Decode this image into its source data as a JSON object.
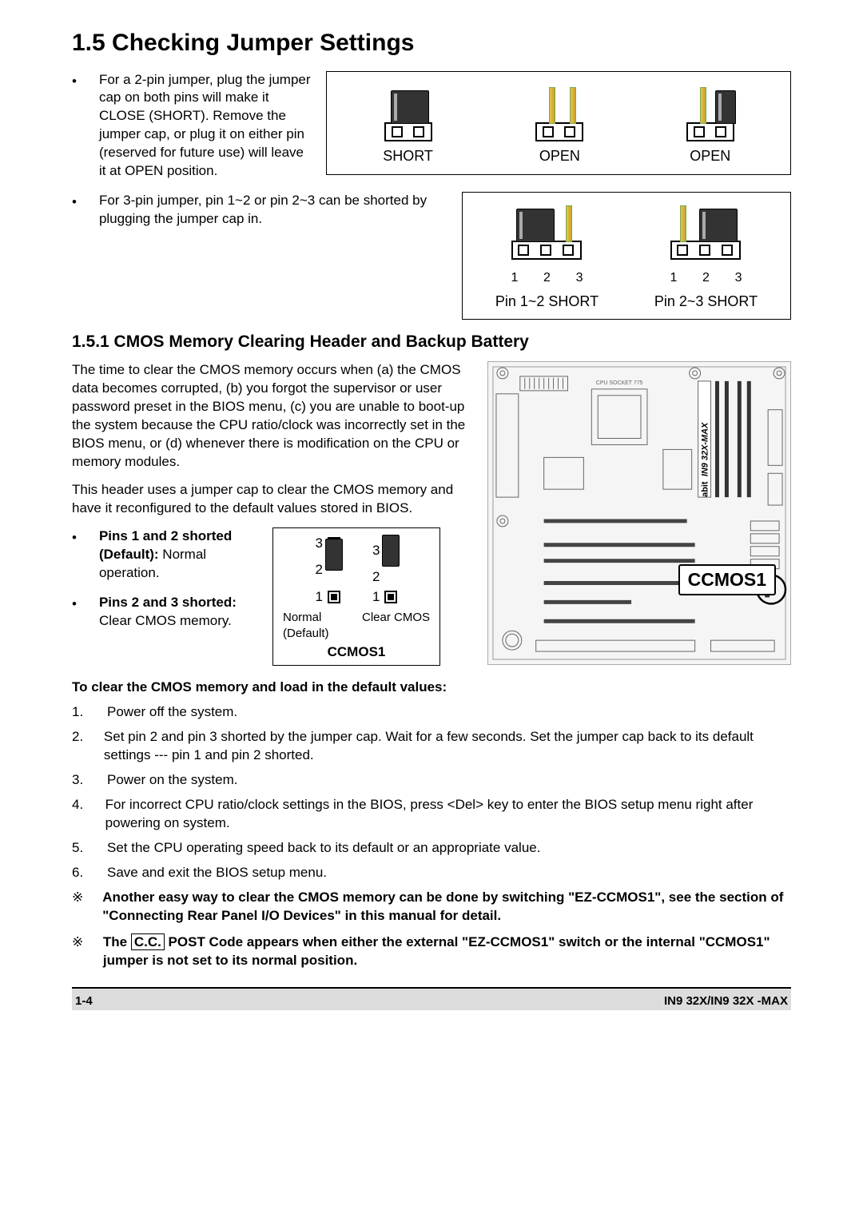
{
  "title": "1.5 Checking Jumper Settings",
  "b1": "For a 2-pin jumper, plug the jumper cap on both pins will make it CLOSE (SHORT). Remove the jumper cap, or plug it on either pin (reserved for future use) will leave it at OPEN position.",
  "l_short": "SHORT",
  "l_open": "OPEN",
  "b2": "For 3-pin jumper, pin 1~2 or pin 2~3 can be shorted by plugging the jumper cap in.",
  "l_pin12": "Pin 1~2 SHORT",
  "l_pin23": "Pin 2~3 SHORT",
  "h2": "1.5.1 CMOS Memory Clearing Header and Backup Battery",
  "p1": "The time to clear the CMOS memory occurs when (a) the CMOS data becomes corrupted, (b) you forgot the supervisor or user password preset in the BIOS menu, (c) you are unable to boot-up the system because the CPU ratio/clock was incorrectly set in the BIOS menu, or (d) whenever there is modification on the CPU or memory modules.",
  "p2": "This header uses a jumper cap to clear the CMOS memory and have it reconfigured to the default values stored in BIOS.",
  "pins12_bold": "Pins 1 and 2 shorted (Default):",
  "pins12_tail": " Normal operation.",
  "pins23_bold": "Pins 2 and 3 shorted:",
  "pins23_tail": " Clear CMOS memory.",
  "ccmos": {
    "normal": "Normal",
    "default": "(Default)",
    "clear": "Clear CMOS",
    "title": "CCMOS1"
  },
  "board_label": "CCMOS1",
  "board_side_text": "IN9 32X-MAX",
  "board_cpu_label": "CPU SOCKET 775",
  "subhead": "To clear the CMOS memory and load in the default values:",
  "steps": [
    "Power off the system.",
    "Set pin 2 and pin 3 shorted by the jumper cap. Wait for a few seconds. Set the jumper cap back to its default settings --- pin 1 and pin 2 shorted.",
    "Power on the system.",
    "For incorrect CPU ratio/clock settings in the BIOS, press <Del> key to enter the BIOS setup menu right after powering on system.",
    "Set the CPU operating speed back to its default or an appropriate value.",
    "Save and exit the BIOS setup menu."
  ],
  "note1": "Another easy way to clear the CMOS memory can be done by switching \"EZ-CCMOS1\", see the section of \"Connecting Rear Panel I/O Devices\" in this manual for detail.",
  "note2_a": "The ",
  "note2_cc": "C.C.",
  "note2_b": " POST Code appears when either the external \"EZ-CCMOS1\" switch or the internal \"CCMOS1\" jumper is not set to its normal position.",
  "footer_left": "1-4",
  "footer_right": "IN9 32X/IN9 32X -MAX",
  "n1": "1",
  "n2": "2",
  "n3": "3",
  "n123": "1 2 3",
  "star": "※"
}
